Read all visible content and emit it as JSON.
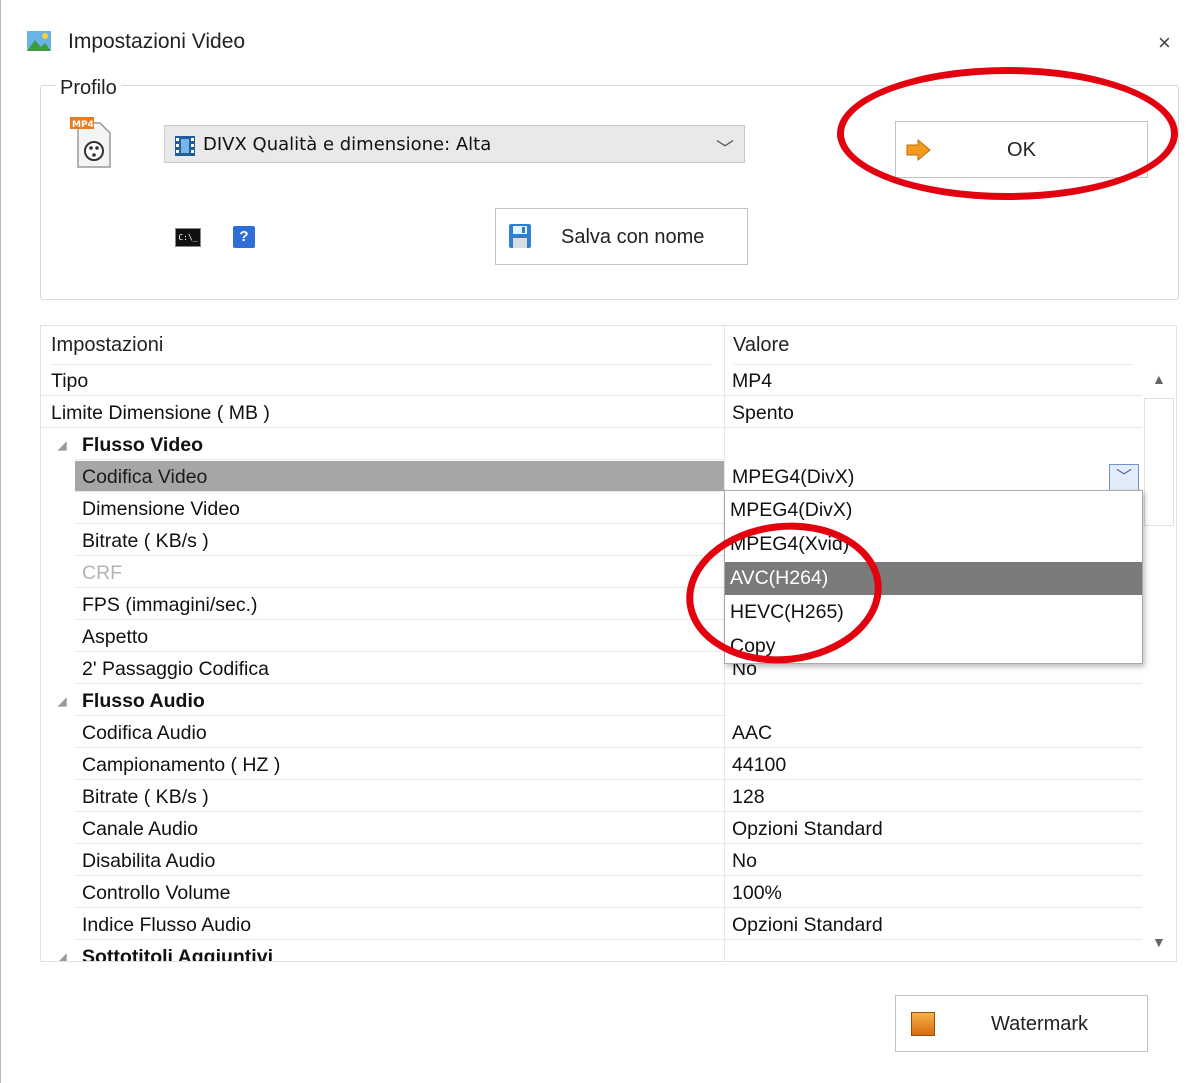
{
  "window": {
    "title": "Impostazioni Video",
    "close_glyph": "×"
  },
  "profile": {
    "group_label": "Profilo",
    "selected": "DIVX Qualità e dimensione: Alta",
    "chevron": "﹀",
    "cmd_icon_text": "C:\\_",
    "help_icon_text": "?",
    "save_as_label": "Salva con nome",
    "ok_label": "OK"
  },
  "grid": {
    "header": {
      "name": "Impostazioni",
      "value": "Valore"
    },
    "rows": [
      {
        "name": "Tipo",
        "value": "MP4"
      },
      {
        "name": "Limite Dimensione ( MB )",
        "value": "Spento"
      },
      {
        "name": "Flusso Video",
        "category": true
      },
      {
        "name": "Codifica Video",
        "value": "MPEG4(DivX)",
        "selected": true
      },
      {
        "name": "Dimensione Video",
        "value": ""
      },
      {
        "name": "Bitrate ( KB/s )",
        "value": ""
      },
      {
        "name": "CRF",
        "value": "",
        "disabled": true
      },
      {
        "name": "FPS (immagini/sec.)",
        "value": ""
      },
      {
        "name": "Aspetto",
        "value": ""
      },
      {
        "name": "2' Passaggio Codifica",
        "value": "No"
      },
      {
        "name": "Flusso Audio",
        "category": true
      },
      {
        "name": "Codifica Audio",
        "value": "AAC"
      },
      {
        "name": "Campionamento ( HZ )",
        "value": "44100"
      },
      {
        "name": "Bitrate ( KB/s )",
        "value": "128"
      },
      {
        "name": "Canale Audio",
        "value": "Opzioni Standard"
      },
      {
        "name": "Disabilita Audio",
        "value": "No"
      },
      {
        "name": "Controllo Volume",
        "value": "100%"
      },
      {
        "name": "Indice Flusso Audio",
        "value": "Opzioni Standard"
      },
      {
        "name": "Sottotitoli Aggiuntivi",
        "category": true
      }
    ],
    "dropdown_glyph": "﹀",
    "scroll_up_glyph": "▲",
    "scroll_down_glyph": "▼",
    "category_glyph": "◢"
  },
  "codec_dropdown": {
    "options": [
      "MPEG4(DivX)",
      "MPEG4(Xvid)",
      "AVC(H264)",
      "HEVC(H265)",
      "Copy"
    ],
    "highlighted": "AVC(H264)"
  },
  "watermark_label": "Watermark",
  "colors": {
    "annotation": "#e3000f",
    "selected_row": "#a6a6a6",
    "highlight_option": "#7a7a7a"
  },
  "icons": [
    "app-icon",
    "close-icon",
    "mp4-file-icon",
    "film-icon",
    "cmd-icon",
    "help-icon",
    "save-icon",
    "arrow-right-icon",
    "watermark-icon"
  ]
}
